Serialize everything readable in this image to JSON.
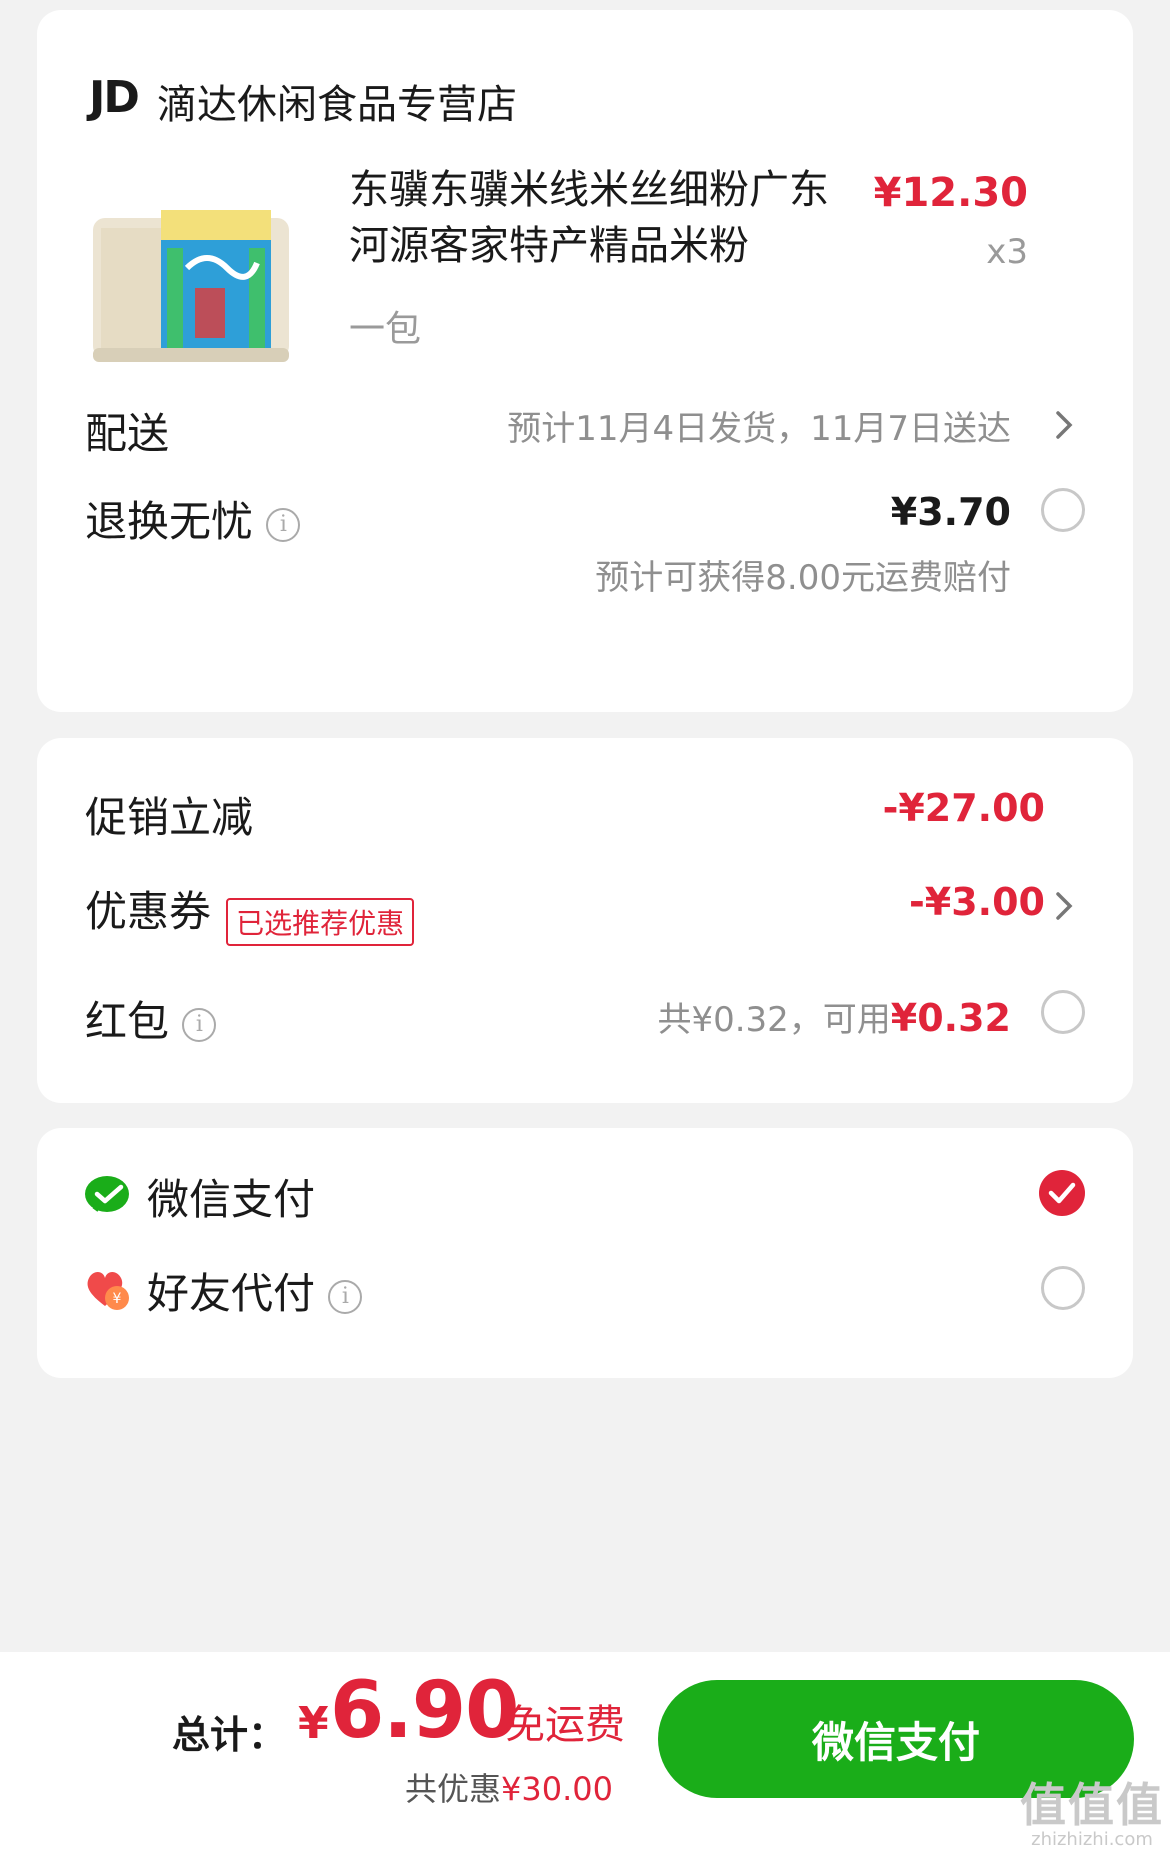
{
  "store": {
    "logo": "JD",
    "name": "滴达休闲食品专营店"
  },
  "product": {
    "title": "东骥东骥米线米丝细粉广东河源客家特产精品米粉",
    "spec": "一包",
    "price": "¥12.30",
    "qty": "x3"
  },
  "delivery": {
    "label": "配送",
    "value": "预计11月4日发货，11月7日送达"
  },
  "return_service": {
    "label": "退换无忧",
    "price": "¥3.70",
    "note": "预计可获得8.00元运费赔付"
  },
  "promotion": {
    "label": "促销立减",
    "value": "-¥27.00"
  },
  "coupon": {
    "label": "优惠券",
    "tag": "已选推荐优惠",
    "value": "-¥3.00"
  },
  "red_packet": {
    "label": "红包",
    "total_text": "共¥0.32，可用",
    "available": "¥0.32"
  },
  "payment": {
    "methods": [
      {
        "label": "微信支付",
        "selected": true,
        "icon": "wechat-pay-icon"
      },
      {
        "label": "好友代付",
        "selected": false,
        "icon": "friend-pay-heart-icon"
      }
    ]
  },
  "footer": {
    "total_label": "总计：",
    "currency": "¥",
    "total_amount": "6.90",
    "shipping": "免运费",
    "saved_prefix": "共优惠",
    "saved_amount": "¥30.00",
    "pay_button": "微信支付"
  },
  "watermark": {
    "big": "值值值",
    "small": "zhizhizhi.com"
  },
  "colors": {
    "accent_red": "#e0243a",
    "wechat_green": "#1aad19",
    "background": "#f2f2f2"
  }
}
